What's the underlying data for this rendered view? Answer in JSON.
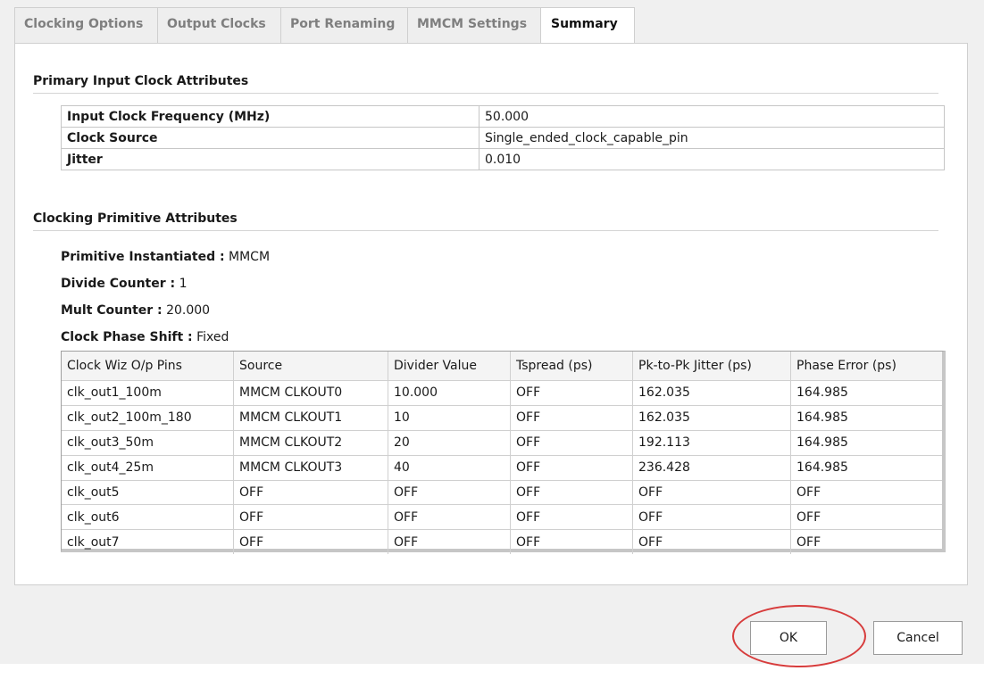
{
  "tabs": [
    {
      "label": "Clocking Options"
    },
    {
      "label": "Output Clocks"
    },
    {
      "label": "Port Renaming"
    },
    {
      "label": "MMCM Settings"
    },
    {
      "label": "Summary"
    }
  ],
  "active_tab": "Summary",
  "primary_input": {
    "title": "Primary Input Clock Attributes",
    "rows": [
      {
        "key": "Input Clock Frequency (MHz)",
        "value": "50.000"
      },
      {
        "key": "Clock Source",
        "value": "Single_ended_clock_capable_pin"
      },
      {
        "key": "Jitter",
        "value": "0.010"
      }
    ]
  },
  "primitive": {
    "title": "Clocking Primitive Attributes",
    "items": [
      {
        "label": "Primitive Instantiated :",
        "value": " MMCM"
      },
      {
        "label": "Divide Counter :",
        "value": " 1"
      },
      {
        "label": "Mult Counter :",
        "value": " 20.000"
      },
      {
        "label": "Clock Phase Shift :",
        "value": " Fixed"
      }
    ]
  },
  "output_table": {
    "headers": [
      "Clock Wiz O/p Pins",
      "Source",
      "Divider Value",
      "Tspread (ps)",
      "Pk-to-Pk Jitter (ps)",
      "Phase Error (ps)"
    ],
    "rows": [
      [
        "clk_out1_100m",
        "MMCM CLKOUT0",
        "10.000",
        "OFF",
        "162.035",
        "164.985"
      ],
      [
        "clk_out2_100m_180",
        "MMCM CLKOUT1",
        "10",
        "OFF",
        "162.035",
        "164.985"
      ],
      [
        "clk_out3_50m",
        "MMCM CLKOUT2",
        "20",
        "OFF",
        "192.113",
        "164.985"
      ],
      [
        "clk_out4_25m",
        "MMCM CLKOUT3",
        "40",
        "OFF",
        "236.428",
        "164.985"
      ],
      [
        "clk_out5",
        "OFF",
        "OFF",
        "OFF",
        "OFF",
        "OFF"
      ],
      [
        "clk_out6",
        "OFF",
        "OFF",
        "OFF",
        "OFF",
        "OFF"
      ],
      [
        "clk_out7",
        "OFF",
        "OFF",
        "OFF",
        "OFF",
        "OFF"
      ]
    ]
  },
  "buttons": {
    "ok": "OK",
    "cancel": "Cancel"
  },
  "colors": {
    "highlight": "#d73c3c",
    "tab_bg": "#eeeeee",
    "panel_border": "#cfcfcf"
  }
}
